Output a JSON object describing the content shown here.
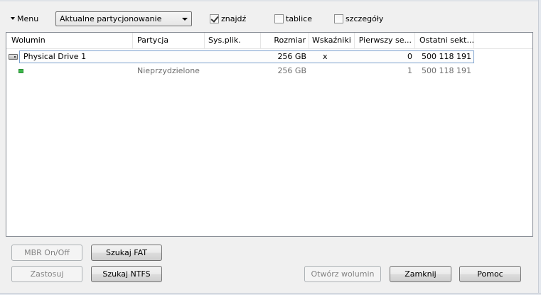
{
  "toolbar": {
    "menu_label": "Menu",
    "view_select_value": "Aktualne partycjonowanie",
    "checkboxes": {
      "find": {
        "label": "znajdź",
        "checked": true
      },
      "tables": {
        "label": "tablice",
        "checked": false
      },
      "details": {
        "label": "szczegóły",
        "checked": false
      }
    }
  },
  "table": {
    "columns": [
      "Wolumin",
      "Partycja",
      "Sys.plik.",
      "Rozmiar",
      "Wskaźniki",
      "Pierwszy se...",
      "Ostatni sekt..."
    ],
    "rows": [
      {
        "volume": "Physical Drive 1",
        "partition": "",
        "filesystem": "",
        "size": "256 GB",
        "flags": "x",
        "first_sector": "0",
        "last_sector": "500 118 191",
        "icon": "drive-icon"
      },
      {
        "volume": "",
        "partition": "Nieprzydzielone",
        "filesystem": "",
        "size": "256 GB",
        "flags": "",
        "first_sector": "1",
        "last_sector": "500 118 191",
        "icon": "partition-icon"
      }
    ]
  },
  "buttons": {
    "mbr_onoff": {
      "label": "MBR On/Off",
      "enabled": false
    },
    "apply": {
      "label": "Zastosuj",
      "enabled": false
    },
    "search_fat": {
      "label": "Szukaj FAT",
      "enabled": true
    },
    "search_ntfs": {
      "label": "Szukaj NTFS",
      "enabled": true
    },
    "open_volume": {
      "label": "Otwórz wolumin",
      "enabled": false
    },
    "close": {
      "label": "Zamknij",
      "enabled": true
    },
    "help": {
      "label": "Pomoc",
      "enabled": true
    }
  }
}
